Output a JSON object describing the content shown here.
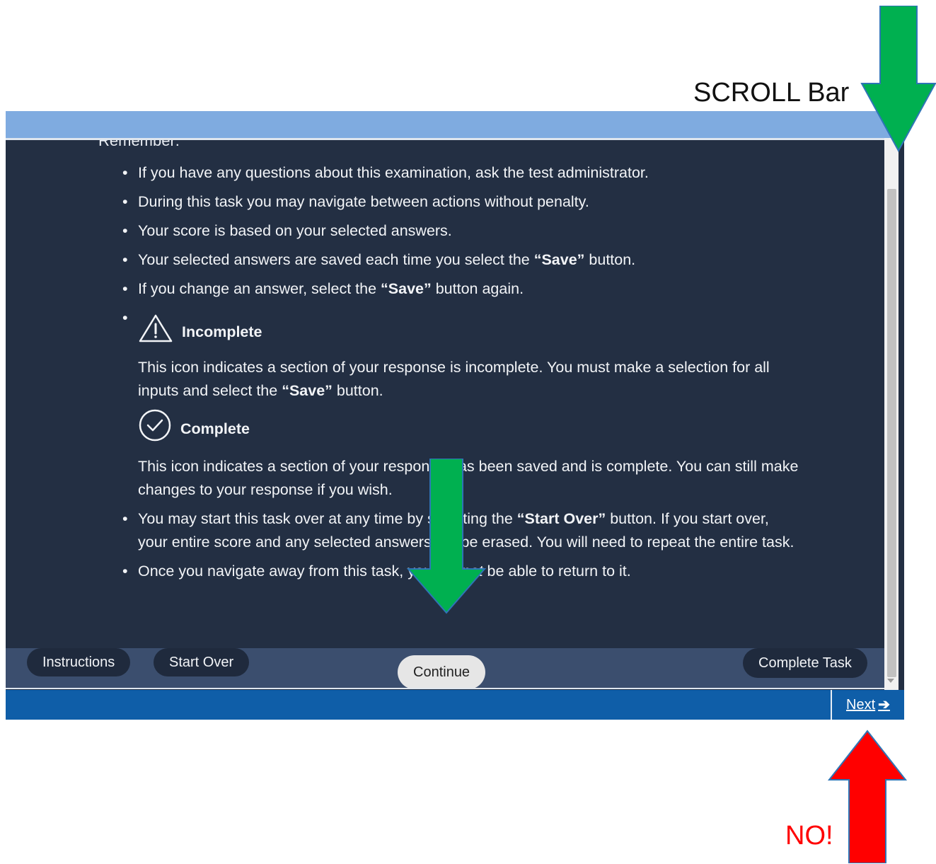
{
  "annotations": {
    "scroll_label": "SCROLL Bar",
    "no_label": "NO!",
    "colors": {
      "green_arrow": "#00b050",
      "red_arrow": "#ff0000"
    }
  },
  "window": {
    "cut_heading": "Remember:",
    "rules": [
      {
        "text": "If you have any questions about this examination, ask the test administrator."
      },
      {
        "text": "During this task you may navigate between actions without penalty."
      },
      {
        "text": "Your score is based on your selected answers."
      },
      {
        "pre": "Your selected answers are saved each time you select the ",
        "bold": "“Save”",
        "post": " button."
      },
      {
        "pre": "If you change an answer, select the ",
        "bold": "“Save”",
        "post": " button again."
      }
    ],
    "incomplete": {
      "icon": "warning-triangle-icon",
      "label": "Incomplete",
      "desc_pre": "This icon indicates a section of your response is incomplete. You must make a selection for all inputs and select the ",
      "desc_bold": "“Save”",
      "desc_post": " button."
    },
    "complete": {
      "icon": "check-circle-icon",
      "label": "Complete",
      "desc": "This icon indicates a section of your response has been saved and is complete. You can still make changes to your response if you wish."
    },
    "start_over_rule": {
      "pre": "You may start this task over at any time by selecting the ",
      "bold": "“Start Over”",
      "post": " button. If you start over, your entire score and any selected answers will be erased. You will need to repeat the entire task."
    },
    "navigate_rule": {
      "pre": "Once you navigate away from this task, you will ",
      "em": "not",
      "post": " be able to return to it."
    }
  },
  "footer": {
    "instructions": "Instructions",
    "start_over": "Start Over",
    "continue": "Continue",
    "complete_task": "Complete Task"
  },
  "bottom_bar": {
    "next": "Next",
    "next_arrow": "➔"
  }
}
